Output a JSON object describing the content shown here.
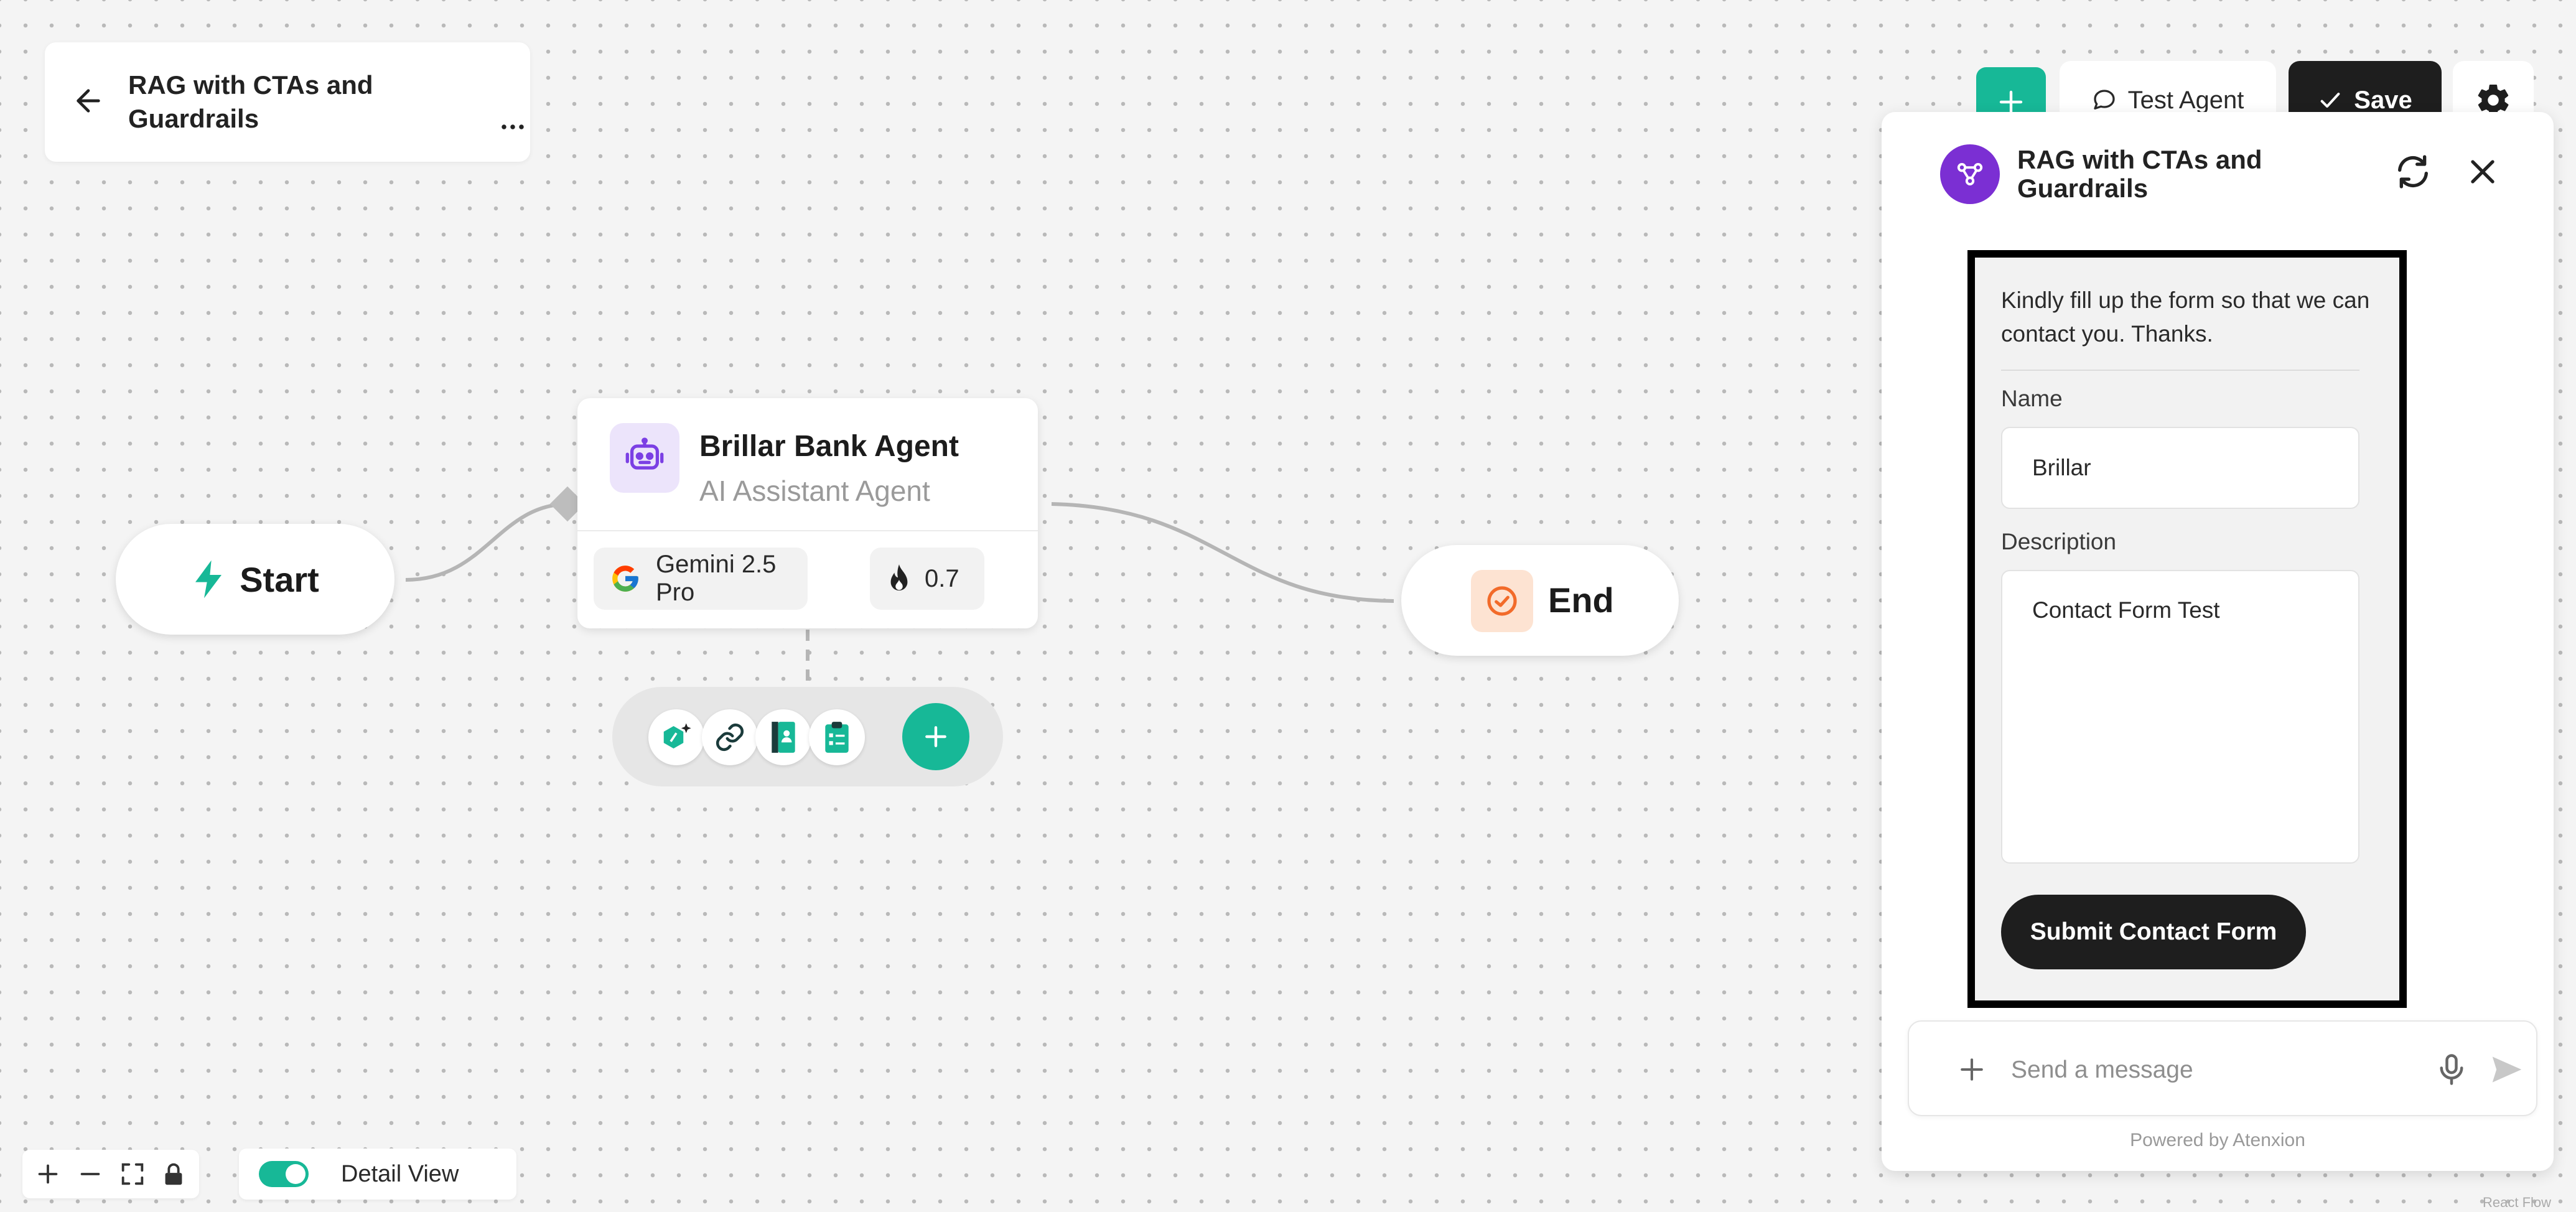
{
  "header": {
    "back_icon": "arrow-left-icon",
    "title": "RAG with CTAs and Guardrails",
    "more_icon": "more-horizontal-icon"
  },
  "canvas": {
    "start_node": {
      "label": "Start",
      "icon": "bolt-icon",
      "icon_color": "#17b897"
    },
    "agent_node": {
      "name": "Brillar Bank Agent",
      "subtitle": "AI Assistant Agent",
      "icon": "robot-icon",
      "model": "Gemini 2.5 Pro",
      "model_icon": "google-icon",
      "temperature": "0.7",
      "temperature_icon": "flame-icon"
    },
    "tools": [
      {
        "name": "ai-tool",
        "icon": "hexagon-sparkle-icon"
      },
      {
        "name": "link-tool",
        "icon": "link-icon"
      },
      {
        "name": "contacts-tool",
        "icon": "contact-book-icon"
      },
      {
        "name": "clipboard-tool",
        "icon": "clipboard-icon"
      }
    ],
    "end_node": {
      "label": "End",
      "icon": "check-circle-icon"
    }
  },
  "toolbar": {
    "add_icon": "plus-icon",
    "test_label": "Test Agent",
    "test_icon": "chat-bubble-icon",
    "save_label": "Save",
    "save_icon": "check-icon",
    "settings_icon": "gear-icon"
  },
  "chat": {
    "title": "RAG with CTAs and Guardrails",
    "avatar_icon": "flow-icon",
    "refresh_icon": "refresh-icon",
    "close_icon": "close-icon",
    "form": {
      "message": "Kindly fill up the form so that we can contact you. Thanks.",
      "name_label": "Name",
      "name_value": "Brillar",
      "description_label": "Description",
      "description_value": "Contact Form Test",
      "submit_label": "Submit Contact Form"
    },
    "composer": {
      "placeholder": "Send a message",
      "attach_icon": "plus-icon",
      "mic_icon": "mic-icon",
      "send_icon": "send-icon"
    },
    "powered_by": "Powered by Atenxion"
  },
  "footer": {
    "zoom_controls": [
      "zoom-in-icon",
      "zoom-out-icon",
      "fit-view-icon",
      "lock-icon"
    ],
    "detail_view_label": "Detail View",
    "detail_view_on": true,
    "attribution": "React Flow"
  },
  "colors": {
    "accent": "#17b897",
    "dark": "#1e1e1e",
    "agent_purple": "#7b2fd3",
    "end_orange": "#f26b2a"
  }
}
